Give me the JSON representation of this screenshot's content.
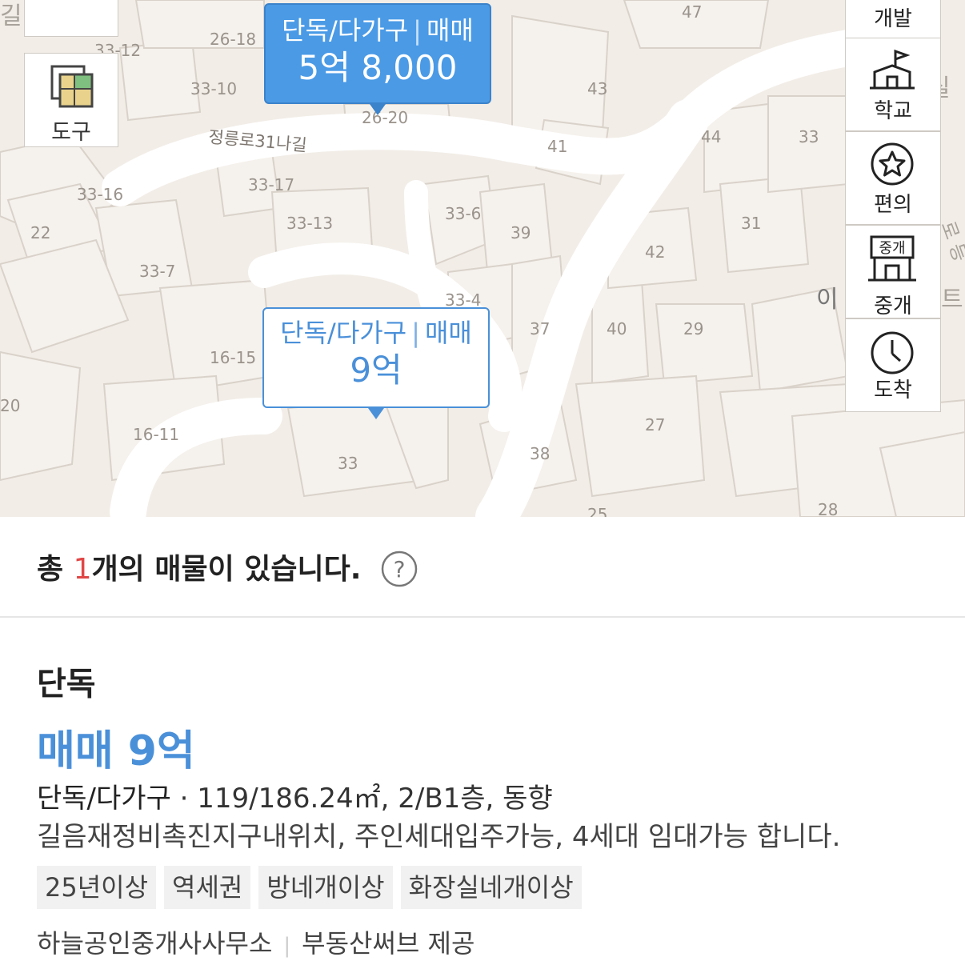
{
  "map": {
    "road_name": "정릉로31나길",
    "lot_numbers": [
      "47",
      "26-18",
      "33-12",
      "33-10",
      "26-20",
      "43",
      "41",
      "44",
      "33",
      "33-16",
      "33-17",
      "33-13",
      "22",
      "33-6",
      "39",
      "31",
      "33-7",
      "42",
      "33-4",
      "16-15",
      "37",
      "40",
      "29",
      "20",
      "16-11",
      "27",
      "33",
      "38",
      "25",
      "28"
    ],
    "edge_labels": [
      "길당",
      "실",
      "이",
      "트",
      "로 등"
    ]
  },
  "tools": {
    "tool_label": "도구"
  },
  "side_menu": [
    {
      "label": "개발",
      "icon": "development-icon"
    },
    {
      "label": "학교",
      "icon": "school-icon"
    },
    {
      "label": "편의",
      "icon": "star-icon"
    },
    {
      "label": "중개",
      "icon": "agency-icon",
      "sign": "중개"
    },
    {
      "label": "도착",
      "icon": "clock-icon"
    }
  ],
  "markers": [
    {
      "type": "단독/다가구",
      "deal": "매매",
      "price": "5억 8,000",
      "selected": true
    },
    {
      "type": "단독/다가구",
      "deal": "매매",
      "price": "9억",
      "selected": false
    }
  ],
  "list": {
    "count_prefix": "총 ",
    "count": "1",
    "count_suffix": "개의 매물이 있습니다.",
    "help": "?"
  },
  "property": {
    "type": "단독",
    "price": "매매 9억",
    "kind": "단독/다가구",
    "dot": " · ",
    "spec": "119/186.24㎡, 2/B1층, 동향",
    "description": "길음재정비촉진지구내위치, 주인세대입주가능, 4세대 임대가능 합니다.",
    "tags": [
      "25년이상",
      "역세권",
      "방네개이상",
      "화장실네개이상"
    ],
    "agency": "하늘공인중개사사무소",
    "provider": "부동산써브 제공"
  },
  "colors": {
    "accent": "#4a90d9",
    "count_highlight": "#e04646",
    "map_bg": "#f2ede7"
  }
}
